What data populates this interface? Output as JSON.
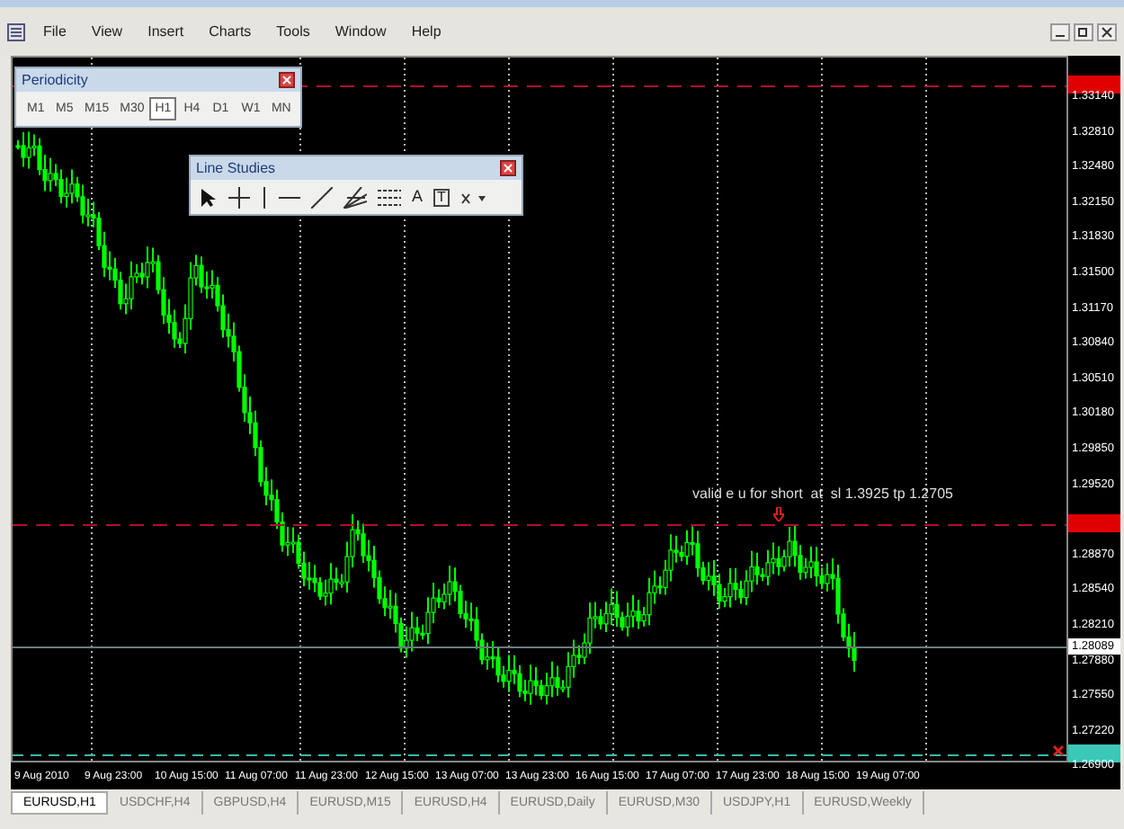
{
  "menu": [
    "File",
    "View",
    "Insert",
    "Charts",
    "Tools",
    "Window",
    "Help"
  ],
  "periodicity": {
    "title": "Periodicity",
    "periods": [
      {
        "label": "M1",
        "selected": false
      },
      {
        "label": "M5",
        "selected": false
      },
      {
        "label": "M15",
        "selected": false
      },
      {
        "label": "M30",
        "selected": false
      },
      {
        "label": "H1",
        "selected": true
      },
      {
        "label": "H4",
        "selected": false
      },
      {
        "label": "D1",
        "selected": false
      },
      {
        "label": "W1",
        "selected": false
      },
      {
        "label": "MN",
        "selected": false
      }
    ]
  },
  "line_studies": {
    "title": "Line Studies",
    "tools": [
      {
        "kind": "cursor"
      },
      {
        "kind": "crosshair"
      },
      {
        "kind": "vertical-line"
      },
      {
        "kind": "horizontal-line"
      },
      {
        "kind": "trendline"
      },
      {
        "kind": "fan"
      },
      {
        "kind": "channel"
      },
      {
        "kind": "text",
        "label": "A"
      },
      {
        "kind": "label",
        "label": "T"
      },
      {
        "kind": "arrows"
      }
    ]
  },
  "chart": {
    "price_labels": [
      "1.33140",
      "1.32810",
      "1.32480",
      "1.32150",
      "1.31830",
      "1.31500",
      "1.31170",
      "1.30840",
      "1.30510",
      "1.30180",
      "1.29850",
      "1.29520",
      "1.28870",
      "1.28540",
      "1.28210",
      "1.27880",
      "1.27550",
      "1.27220",
      "1.26900"
    ],
    "current_price": "1.28089",
    "annotation": "valid e u for short  at  sl 1.3925 tp 1.2705",
    "time_labels": [
      "9 Aug 2010",
      "9 Aug 23:00",
      "10 Aug 15:00",
      "11 Aug 07:00",
      "11 Aug 23:00",
      "12 Aug 15:00",
      "13 Aug 07:00",
      "13 Aug 23:00",
      "16 Aug 15:00",
      "17 Aug 07:00",
      "17 Aug 23:00",
      "18 Aug 15:00",
      "19 Aug 07:00"
    ]
  },
  "tabs": [
    {
      "label": "EURUSD,H1",
      "selected": true
    },
    {
      "label": "USDCHF,H4",
      "selected": false
    },
    {
      "label": "GBPUSD,H4",
      "selected": false
    },
    {
      "label": "EURUSD,M15",
      "selected": false
    },
    {
      "label": "EURUSD,H4",
      "selected": false
    },
    {
      "label": "EURUSD,Daily",
      "selected": false
    },
    {
      "label": "EURUSD,M30",
      "selected": false
    },
    {
      "label": "USDJPY,H1",
      "selected": false
    },
    {
      "label": "EURUSD,Weekly",
      "selected": false
    }
  ]
}
